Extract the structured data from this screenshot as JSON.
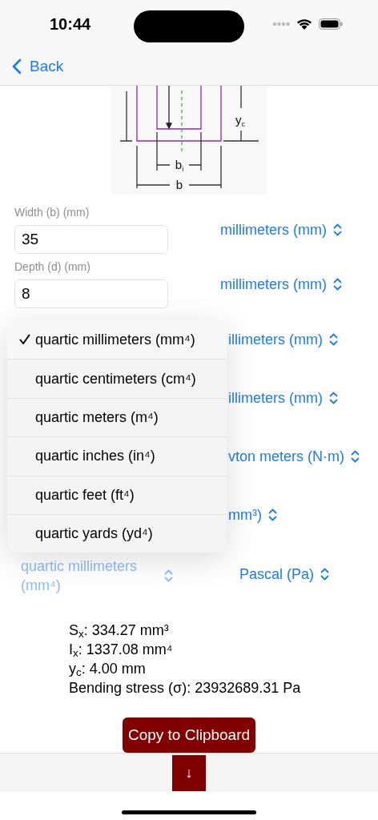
{
  "status_bar": {
    "time": "10:44"
  },
  "nav": {
    "back": "Back"
  },
  "diagram": {
    "labels": [
      {
        "kind": "yc",
        "main": "y",
        "sub": "c"
      },
      {
        "kind": "bi",
        "main": "b",
        "sub": "i"
      },
      {
        "kind": "b",
        "main": "b"
      }
    ]
  },
  "form_rows": [
    {
      "kind": "input",
      "label": "Width (b) (mm)",
      "value": "35",
      "unit": "millimeters (mm)"
    },
    {
      "kind": "input",
      "label": "Depth (d) (mm)",
      "value": "8",
      "unit": "millimeters (mm)"
    },
    {
      "kind": "covered",
      "unit": "illimeters (mm)"
    },
    {
      "kind": "covered",
      "unit": "illimeters (mm)"
    },
    {
      "kind": "covered",
      "unit": "vton meters (N·m)"
    },
    {
      "kind": "covered",
      "unit": "mm³)"
    },
    {
      "kind": "pickers",
      "left_unit": "quartic millimeters (mm⁴)",
      "open": true,
      "unit": "Pascal (Pa)"
    }
  ],
  "results": [
    "S$_{x}$: 334.27 mm³",
    "I$_{x}$: 1337.08 mm⁴",
    "y$_{c}$: 4.00  mm",
    "Bending stress (σ): 23932689.31  Pa"
  ],
  "copy_button": "Copy to Clipboard",
  "toolbar": {
    "button": "↓"
  },
  "menu": {
    "items": [
      {
        "label": "quartic millimeters (mm⁴)",
        "selected": true
      },
      {
        "label": "quartic centimeters (cm⁴)",
        "selected": false
      },
      {
        "label": "quartic meters (m⁴)",
        "selected": false
      },
      {
        "label": "quartic inches (in⁴)",
        "selected": false
      },
      {
        "label": "quartic feet (ft⁴)",
        "selected": false
      },
      {
        "label": "quartic yards (yd⁴)",
        "selected": false
      }
    ]
  }
}
